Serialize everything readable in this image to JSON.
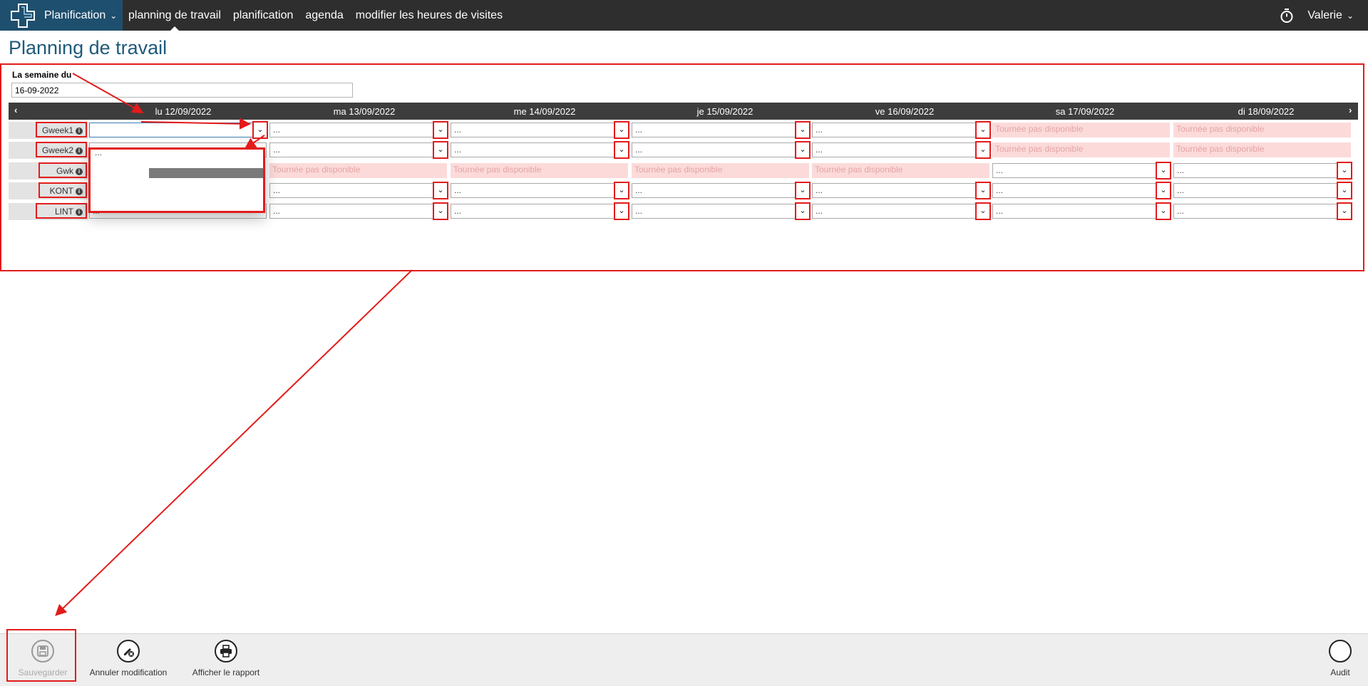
{
  "app": {
    "name": "Planification"
  },
  "nav": {
    "items": [
      "planning de travail",
      "planification",
      "agenda",
      "modifier les heures de visites"
    ]
  },
  "user": {
    "name": "Valerie"
  },
  "page": {
    "title": "Planning de travail"
  },
  "week": {
    "label": "La semaine du",
    "value": "16-09-2022"
  },
  "days": [
    "lu 12/09/2022",
    "ma 13/09/2022",
    "me 14/09/2022",
    "je 15/09/2022",
    "ve 16/09/2022",
    "sa 17/09/2022",
    "di 18/09/2022"
  ],
  "rows": [
    {
      "label": "Gweek1",
      "cells": [
        "",
        "...",
        "...",
        "...",
        "...",
        "Tournée pas disponible",
        "Tournée pas disponible"
      ]
    },
    {
      "label": "Gweek2",
      "cells": [
        "...",
        "...",
        "...",
        "...",
        "...",
        "Tournée pas disponible",
        "Tournée pas disponible"
      ]
    },
    {
      "label": "Gwk",
      "cells": [
        "",
        "Tournée pas disponible",
        "Tournée pas disponible",
        "Tournée pas disponible",
        "Tournée pas disponible",
        "...",
        "..."
      ]
    },
    {
      "label": "KONT",
      "cells": [
        "",
        "...",
        "...",
        "...",
        "...",
        "...",
        "..."
      ]
    },
    {
      "label": "LINT",
      "cells": [
        "...",
        "...",
        "...",
        "...",
        "...",
        "...",
        "..."
      ]
    }
  ],
  "dropdown": {
    "first_option": "..."
  },
  "toolbar": {
    "save": "Sauvegarder",
    "cancel": "Annuler modification",
    "report": "Afficher le rapport",
    "audit": "Audit"
  },
  "colors": {
    "brand": "#1e4f6e",
    "topbar": "#2e2e2e",
    "title": "#1e5a7a",
    "annotation": "#e31b1b",
    "unavailable": "#fcdada"
  }
}
